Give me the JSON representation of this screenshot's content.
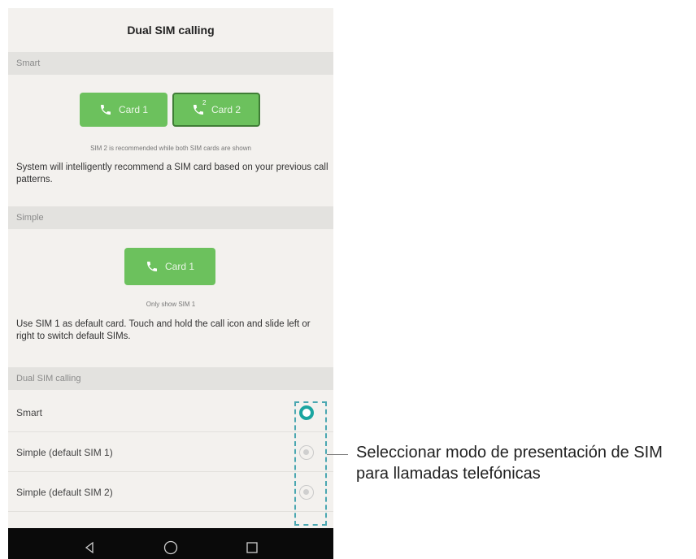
{
  "header": {
    "title": "Dual SIM calling"
  },
  "smart_section": {
    "heading": "Smart",
    "card1_label": "Card 1",
    "card2_label": "Card 2",
    "card2_sup": "2",
    "caption": "SIM 2 is recommended while both SIM cards are shown",
    "description": "System will intelligently recommend a SIM card based on your previous call patterns."
  },
  "simple_section": {
    "heading": "Simple",
    "card1_label": "Card 1",
    "caption": "Only show SIM 1",
    "description": "Use SIM 1 as default card. Touch and hold the call icon and slide left or right to switch default SIMs."
  },
  "options_section": {
    "heading": "Dual SIM calling",
    "items": [
      {
        "label": "Smart",
        "selected": true
      },
      {
        "label": "Simple (default SIM 1)",
        "selected": false
      },
      {
        "label": "Simple (default SIM 2)",
        "selected": false
      }
    ]
  },
  "annotation": {
    "text": "Seleccionar modo de presentación de SIM para llamadas telefónicas"
  },
  "colors": {
    "card_green": "#6cc15d",
    "radio_teal": "#1aa5a0",
    "dash_teal": "#4aa7b1"
  }
}
